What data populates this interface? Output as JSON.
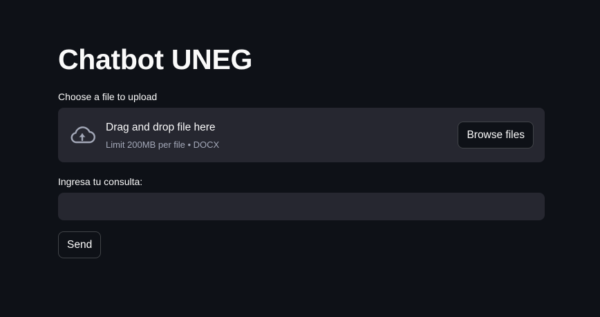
{
  "page": {
    "title": "Chatbot UNEG"
  },
  "uploader": {
    "label": "Choose a file to upload",
    "drop_title": "Drag and drop file here",
    "drop_subtitle": "Limit 200MB per file • DOCX",
    "browse_label": "Browse files",
    "icon": "cloud-upload-icon"
  },
  "query": {
    "label": "Ingresa tu consulta:",
    "value": "",
    "placeholder": ""
  },
  "actions": {
    "send_label": "Send"
  },
  "colors": {
    "background": "#0e1117",
    "panel": "#262730",
    "text": "#fafafa",
    "muted_text": "#a3a8b8"
  }
}
